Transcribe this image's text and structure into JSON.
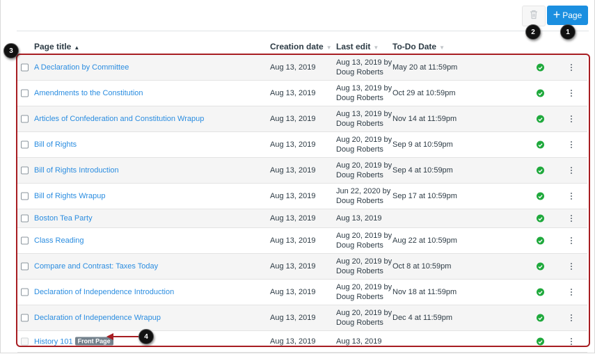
{
  "toolbar": {
    "delete_icon": "trash-icon",
    "add_page_label": "Page",
    "add_page_icon": "plus-icon"
  },
  "callouts": [
    "1",
    "2",
    "3",
    "4"
  ],
  "columns": {
    "title": "Page title",
    "created": "Creation date",
    "edited": "Last edit",
    "todo": "To-Do Date"
  },
  "sort": {
    "column": "title",
    "direction": "ascending"
  },
  "rows": [
    {
      "title": "A Declaration by Committee",
      "created": "Aug 13, 2019",
      "edited_date": "Aug 13, 2019 by",
      "edited_by": "Doug Roberts",
      "todo": "May 20 at 11:59pm",
      "published": true
    },
    {
      "title": "Amendments to the Constitution",
      "created": "Aug 13, 2019",
      "edited_date": "Aug 13, 2019 by",
      "edited_by": "Doug Roberts",
      "todo": "Oct 29 at 10:59pm",
      "published": true
    },
    {
      "title": "Articles of Confederation and Constitution Wrapup",
      "created": "Aug 13, 2019",
      "edited_date": "Aug 13, 2019 by",
      "edited_by": "Doug Roberts",
      "todo": "Nov 14 at 11:59pm",
      "published": true
    },
    {
      "title": "Bill of Rights",
      "created": "Aug 13, 2019",
      "edited_date": "Aug 20, 2019 by",
      "edited_by": "Doug Roberts",
      "todo": "Sep 9 at 10:59pm",
      "published": true
    },
    {
      "title": "Bill of Rights Introduction",
      "created": "Aug 13, 2019",
      "edited_date": "Aug 20, 2019 by",
      "edited_by": "Doug Roberts",
      "todo": "Sep 4 at 10:59pm",
      "published": true
    },
    {
      "title": "Bill of Rights Wrapup",
      "created": "Aug 13, 2019",
      "edited_date": "Jun 22, 2020 by",
      "edited_by": "Doug Roberts",
      "todo": "Sep 17 at 10:59pm",
      "published": true
    },
    {
      "title": "Boston Tea Party",
      "created": "Aug 13, 2019",
      "edited_date": "Aug 13, 2019",
      "edited_by": "",
      "todo": "",
      "published": true
    },
    {
      "title": "Class Reading",
      "created": "Aug 13, 2019",
      "edited_date": "Aug 20, 2019 by",
      "edited_by": "Doug Roberts",
      "todo": "Aug 22 at 10:59pm",
      "published": true
    },
    {
      "title": "Compare and Contrast: Taxes Today",
      "created": "Aug 13, 2019",
      "edited_date": "Aug 20, 2019 by",
      "edited_by": "Doug Roberts",
      "todo": "Oct 8 at 10:59pm",
      "published": true
    },
    {
      "title": "Declaration of Independence Introduction",
      "created": "Aug 13, 2019",
      "edited_date": "Aug 20, 2019 by",
      "edited_by": "Doug Roberts",
      "todo": "Nov 18 at 11:59pm",
      "published": true
    },
    {
      "title": "Declaration of Independence Wrapup",
      "created": "Aug 13, 2019",
      "edited_date": "Aug 20, 2019 by",
      "edited_by": "Doug Roberts",
      "todo": "Dec 4 at 11:59pm",
      "published": true
    },
    {
      "title": "History 101",
      "badge": "Front Page",
      "created": "Aug 13, 2019",
      "edited_date": "Aug 13, 2019",
      "edited_by": "",
      "todo": "",
      "published": true,
      "checkbox_disabled": true
    }
  ],
  "colors": {
    "link": "#2b8de0",
    "primary_button": "#1b8fe0",
    "published": "#1fa93c",
    "annotation": "#a71d22",
    "badge": "#73818c"
  }
}
